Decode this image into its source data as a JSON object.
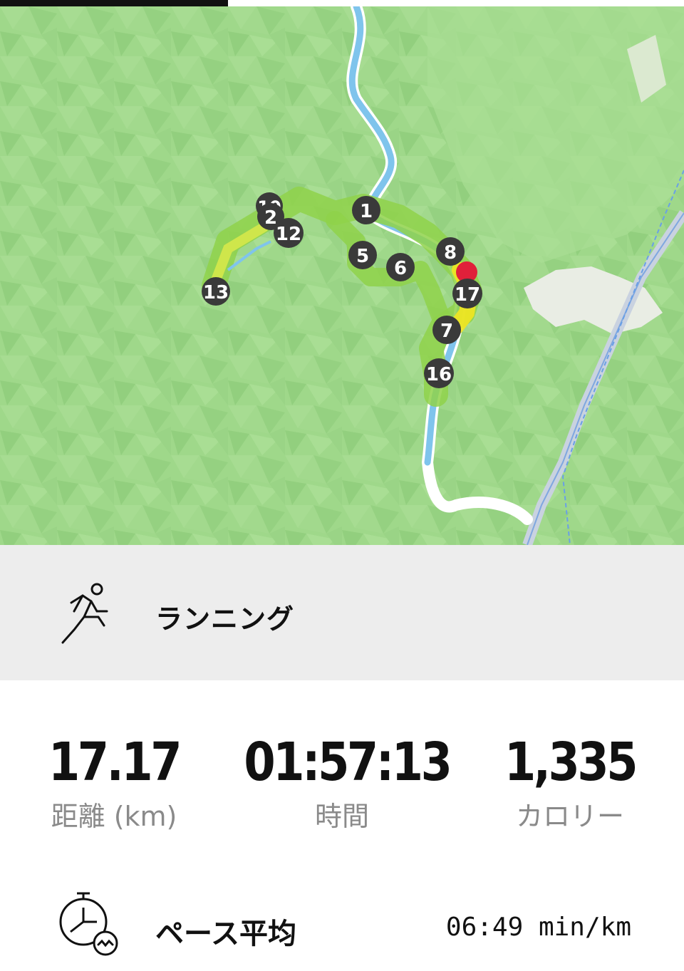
{
  "map": {
    "markers": [
      {
        "label": "10"
      },
      {
        "label": "2"
      },
      {
        "label": "12"
      },
      {
        "label": "13"
      },
      {
        "label": "1"
      },
      {
        "label": "5"
      },
      {
        "label": "6"
      },
      {
        "label": "8"
      },
      {
        "label": "17"
      },
      {
        "label": "7"
      },
      {
        "label": "16"
      }
    ]
  },
  "activity": {
    "type_label": "ランニング",
    "icon": "runner-icon"
  },
  "stats": [
    {
      "value": "17.17",
      "label": "距離 (km)"
    },
    {
      "value": "01:57:13",
      "label": "時間"
    },
    {
      "value": "1,335",
      "label": "カロリー"
    }
  ],
  "pace": {
    "label": "ペース平均",
    "value": "06:49 min/km",
    "icon": "stopwatch-icon"
  },
  "colors": {
    "map_land": "#9fd88a",
    "water": "#7fc4ec",
    "marker": "#3a3a3a",
    "end_marker": "#e0203a",
    "route_fast": "#f2e520",
    "route_slow": "#8fd24a"
  }
}
